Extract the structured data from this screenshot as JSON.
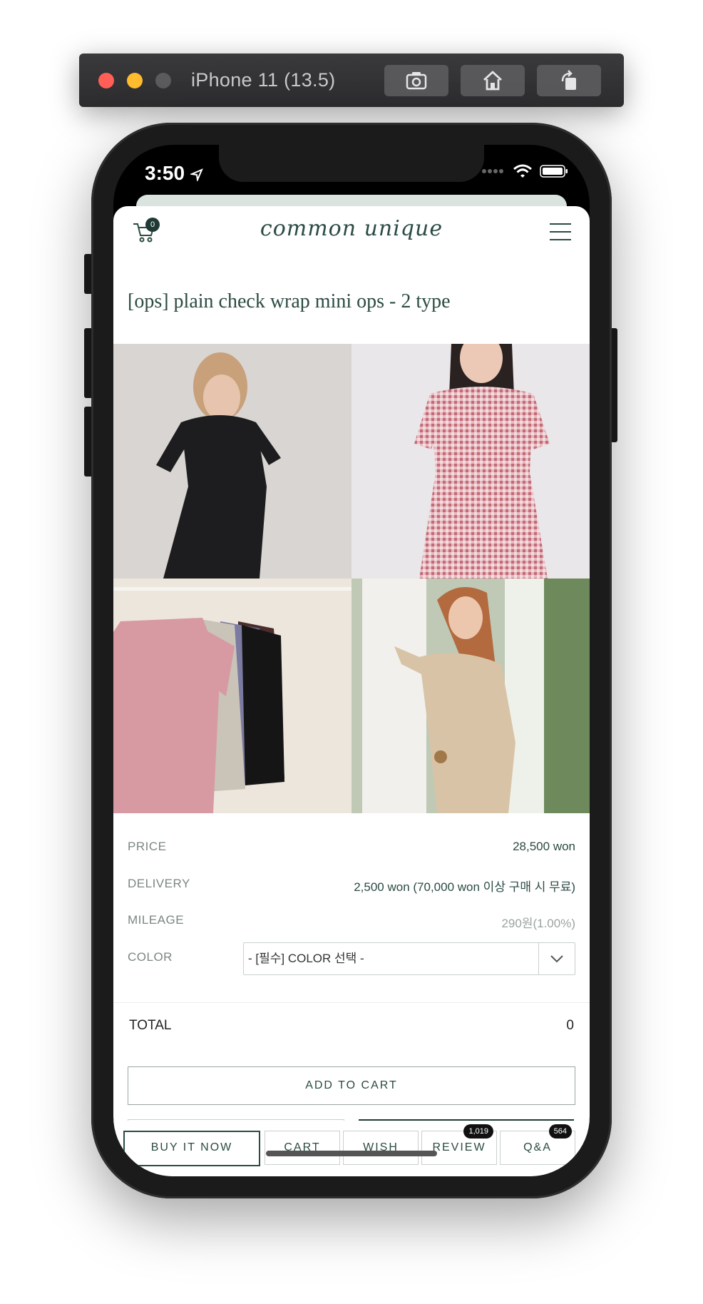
{
  "simulator": {
    "title": "iPhone 11 (13.5)",
    "buttons": [
      "screenshot-icon",
      "home-icon",
      "rotate-icon"
    ]
  },
  "status_bar": {
    "time": "3:50",
    "icons": [
      "location-arrow-icon",
      "signal-icon",
      "wifi-icon",
      "battery-icon"
    ]
  },
  "header": {
    "logo": "common unique",
    "cart_count": "0"
  },
  "product": {
    "title": "[ops] plain check wrap mini ops - 2 type"
  },
  "info": {
    "price_label": "PRICE",
    "price_value": "28,500 won",
    "delivery_label": "DELIVERY",
    "delivery_value": "2,500 won (70,000 won 이상 구매 시 무료)",
    "mileage_label": "MILEAGE",
    "mileage_value": "290원(1.00%)",
    "color_label": "COLOR",
    "color_select": "- [필수] COLOR 선택 -"
  },
  "total": {
    "label": "TOTAL",
    "value": "0"
  },
  "actions": {
    "add_to_cart": "ADD TO CART"
  },
  "bottom_bar": {
    "buy_now": "BUY IT NOW",
    "cart": "CART",
    "wish": "WISH",
    "review": "REVIEW",
    "review_count": "1,019",
    "qa": "Q&A",
    "qa_count": "564"
  },
  "colors": {
    "brand": "#2b4b43",
    "brand_dark": "#1f3a35"
  }
}
